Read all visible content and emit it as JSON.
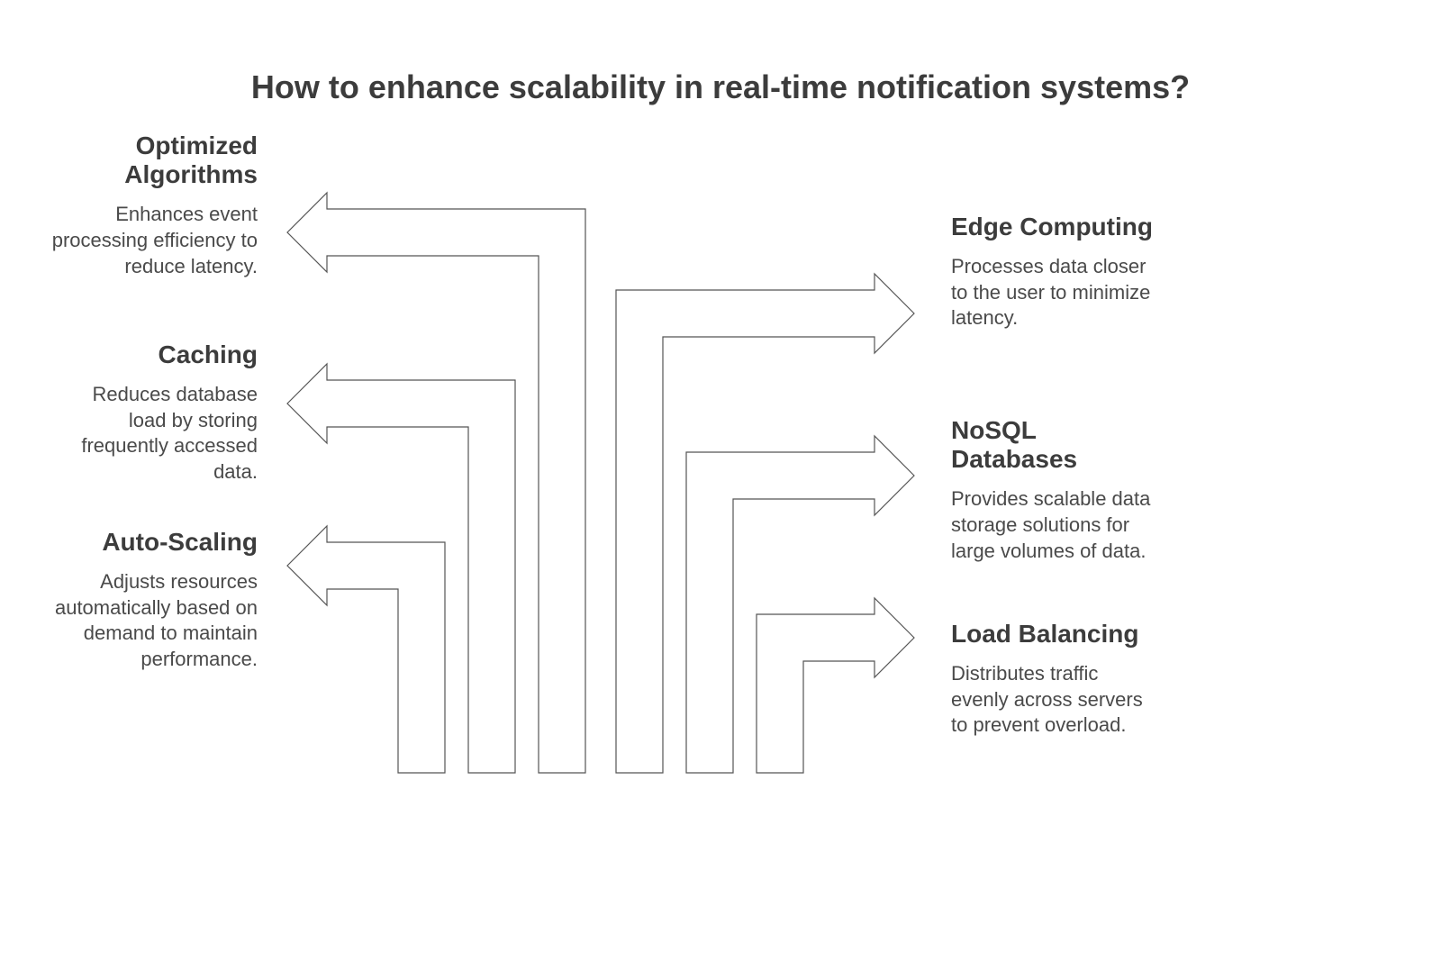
{
  "title": "How to enhance scalability in real-time notification systems?",
  "left": [
    {
      "heading": "Optimized Algorithms",
      "desc": "Enhances event processing efficiency to reduce latency."
    },
    {
      "heading": "Caching",
      "desc": "Reduces database load by storing frequently accessed data."
    },
    {
      "heading": "Auto-Scaling",
      "desc": "Adjusts resources automatically based on demand to maintain performance."
    }
  ],
  "right": [
    {
      "heading": "Edge Computing",
      "desc": "Processes data closer to the user to minimize latency."
    },
    {
      "heading": "NoSQL Databases",
      "desc": "Provides scalable data storage solutions for large volumes of data."
    },
    {
      "heading": "Load Balancing",
      "desc": "Distributes traffic evenly across servers to prevent overload."
    }
  ]
}
